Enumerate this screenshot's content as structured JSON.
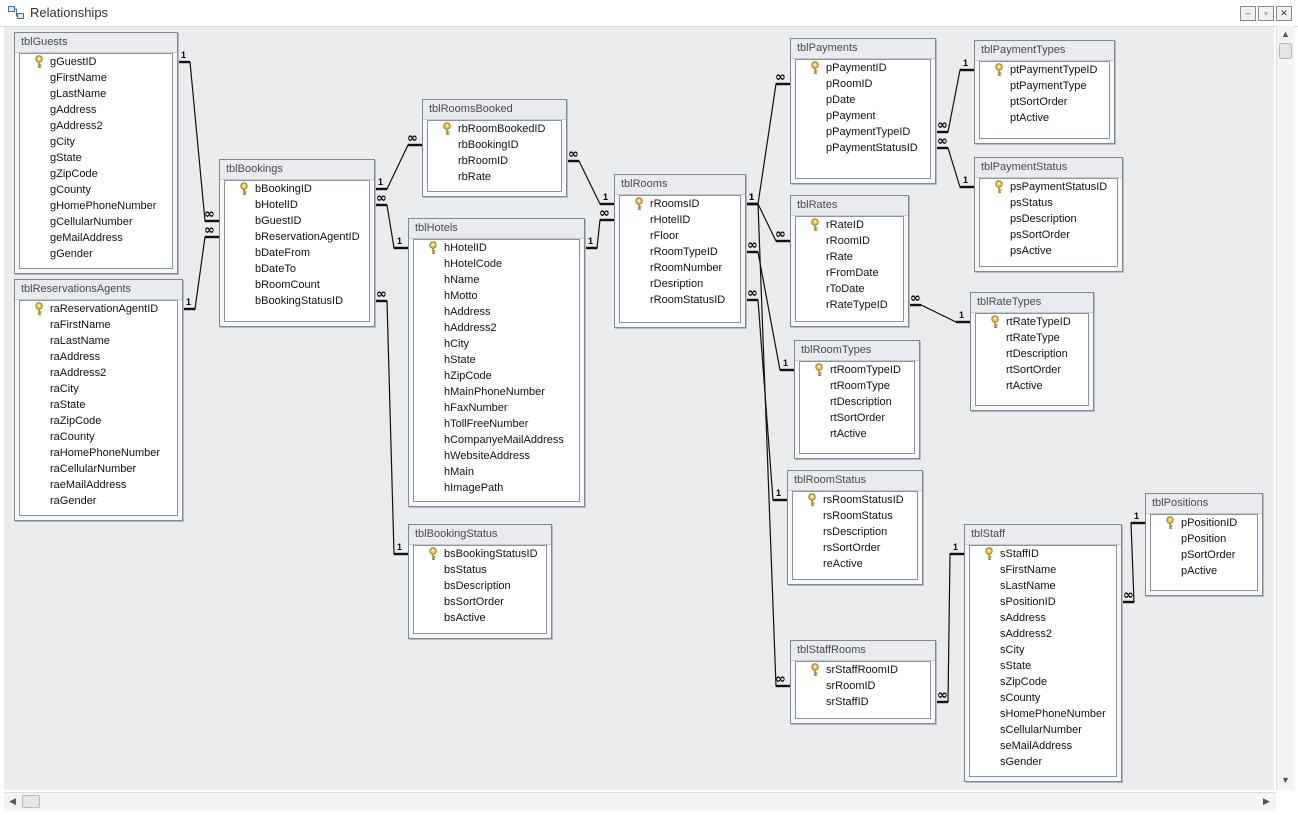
{
  "window": {
    "title": "Relationships",
    "minimize": "–",
    "restore": "▫",
    "close": "✕"
  },
  "tables": [
    {
      "id": "tblGuests",
      "name": "tblGuests",
      "fields": [
        {
          "name": "gGuestID",
          "pk": true
        },
        {
          "name": "gFirstName"
        },
        {
          "name": "gLastName"
        },
        {
          "name": "gAddress"
        },
        {
          "name": "gAddress2"
        },
        {
          "name": "gCity"
        },
        {
          "name": "gState"
        },
        {
          "name": "gZipCode"
        },
        {
          "name": "gCounty"
        },
        {
          "name": "gHomePhoneNumber"
        },
        {
          "name": "gCellularNumber"
        },
        {
          "name": "geMailAddress"
        },
        {
          "name": "gGender"
        }
      ]
    },
    {
      "id": "tblReservationsAgents",
      "name": "tblReservationsAgents",
      "fields": [
        {
          "name": "raReservationAgentID",
          "pk": true
        },
        {
          "name": "raFirstName"
        },
        {
          "name": "raLastName"
        },
        {
          "name": "raAddress"
        },
        {
          "name": "raAddress2"
        },
        {
          "name": "raCity"
        },
        {
          "name": "raState"
        },
        {
          "name": "raZipCode"
        },
        {
          "name": "raCounty"
        },
        {
          "name": "raHomePhoneNumber"
        },
        {
          "name": "raCellularNumber"
        },
        {
          "name": "raeMailAddress"
        },
        {
          "name": "raGender"
        }
      ]
    },
    {
      "id": "tblBookings",
      "name": "tblBookings",
      "fields": [
        {
          "name": "bBookingID",
          "pk": true
        },
        {
          "name": "bHotelID"
        },
        {
          "name": "bGuestID"
        },
        {
          "name": "bReservationAgentID"
        },
        {
          "name": "bDateFrom"
        },
        {
          "name": "bDateTo"
        },
        {
          "name": "bRoomCount"
        },
        {
          "name": "bBookingStatusID"
        }
      ]
    },
    {
      "id": "tblRoomsBooked",
      "name": "tblRoomsBooked",
      "fields": [
        {
          "name": "rbRoomBookedID",
          "pk": true
        },
        {
          "name": "rbBookingID"
        },
        {
          "name": "rbRoomID"
        },
        {
          "name": "rbRate"
        }
      ]
    },
    {
      "id": "tblHotels",
      "name": "tblHotels",
      "fields": [
        {
          "name": "hHotelID",
          "pk": true
        },
        {
          "name": "hHotelCode"
        },
        {
          "name": "hName"
        },
        {
          "name": "hMotto"
        },
        {
          "name": "hAddress"
        },
        {
          "name": "hAddress2"
        },
        {
          "name": "hCity"
        },
        {
          "name": "hState"
        },
        {
          "name": "hZipCode"
        },
        {
          "name": "hMainPhoneNumber"
        },
        {
          "name": "hFaxNumber"
        },
        {
          "name": "hTollFreeNumber"
        },
        {
          "name": "hCompanyeMailAddress"
        },
        {
          "name": "hWebsiteAddress"
        },
        {
          "name": "hMain"
        },
        {
          "name": "hImagePath"
        }
      ]
    },
    {
      "id": "tblBookingStatus",
      "name": "tblBookingStatus",
      "fields": [
        {
          "name": "bsBookingStatusID",
          "pk": true
        },
        {
          "name": "bsStatus"
        },
        {
          "name": "bsDescription"
        },
        {
          "name": "bsSortOrder"
        },
        {
          "name": "bsActive"
        }
      ]
    },
    {
      "id": "tblRooms",
      "name": "tblRooms",
      "fields": [
        {
          "name": "rRoomsID",
          "pk": true
        },
        {
          "name": "rHotelID"
        },
        {
          "name": "rFloor"
        },
        {
          "name": "rRoomTypeID"
        },
        {
          "name": "rRoomNumber"
        },
        {
          "name": "rDesription"
        },
        {
          "name": "rRoomStatusID"
        }
      ]
    },
    {
      "id": "tblPayments",
      "name": "tblPayments",
      "fields": [
        {
          "name": "pPaymentID",
          "pk": true
        },
        {
          "name": "pRoomID"
        },
        {
          "name": "pDate"
        },
        {
          "name": "pPayment"
        },
        {
          "name": "pPaymentTypeID"
        },
        {
          "name": "pPaymentStatusID"
        }
      ]
    },
    {
      "id": "tblPaymentTypes",
      "name": "tblPaymentTypes",
      "fields": [
        {
          "name": "ptPaymentTypeID",
          "pk": true
        },
        {
          "name": "ptPaymentType"
        },
        {
          "name": "ptSortOrder"
        },
        {
          "name": "ptActive"
        }
      ]
    },
    {
      "id": "tblPaymentStatus",
      "name": "tblPaymentStatus",
      "fields": [
        {
          "name": "psPaymentStatusID",
          "pk": true
        },
        {
          "name": "psStatus"
        },
        {
          "name": "psDescription"
        },
        {
          "name": "psSortOrder"
        },
        {
          "name": "psActive"
        }
      ]
    },
    {
      "id": "tblRates",
      "name": "tblRates",
      "fields": [
        {
          "name": "rRateID",
          "pk": true
        },
        {
          "name": "rRoomID"
        },
        {
          "name": "rRate"
        },
        {
          "name": "rFromDate"
        },
        {
          "name": "rToDate"
        },
        {
          "name": "rRateTypeID"
        }
      ]
    },
    {
      "id": "tblRateTypes",
      "name": "tblRateTypes",
      "fields": [
        {
          "name": "rtRateTypeID",
          "pk": true
        },
        {
          "name": "rtRateType"
        },
        {
          "name": "rtDescription"
        },
        {
          "name": "rtSortOrder"
        },
        {
          "name": "rtActive"
        }
      ]
    },
    {
      "id": "tblRoomTypes",
      "name": "tblRoomTypes",
      "fields": [
        {
          "name": "rtRoomTypeID",
          "pk": true
        },
        {
          "name": "rtRoomType"
        },
        {
          "name": "rtDescription"
        },
        {
          "name": "rtSortOrder"
        },
        {
          "name": "rtActive"
        }
      ]
    },
    {
      "id": "tblRoomStatus",
      "name": "tblRoomStatus",
      "fields": [
        {
          "name": "rsRoomStatusID",
          "pk": true
        },
        {
          "name": "rsRoomStatus"
        },
        {
          "name": "rsDescription"
        },
        {
          "name": "rsSortOrder"
        },
        {
          "name": "reActive"
        }
      ]
    },
    {
      "id": "tblStaffRooms",
      "name": "tblStaffRooms",
      "fields": [
        {
          "name": "srStaffRoomID",
          "pk": true
        },
        {
          "name": "srRoomID"
        },
        {
          "name": "srStaffID"
        }
      ]
    },
    {
      "id": "tblStaff",
      "name": "tblStaff",
      "fields": [
        {
          "name": "sStaffID",
          "pk": true
        },
        {
          "name": "sFirstName"
        },
        {
          "name": "sLastName"
        },
        {
          "name": "sPositionID"
        },
        {
          "name": "sAddress"
        },
        {
          "name": "sAddress2"
        },
        {
          "name": "sCity"
        },
        {
          "name": "sState"
        },
        {
          "name": "sZipCode"
        },
        {
          "name": "sCounty"
        },
        {
          "name": "sHomePhoneNumber"
        },
        {
          "name": "sCellularNumber"
        },
        {
          "name": "seMailAddress"
        },
        {
          "name": "sGender"
        }
      ]
    },
    {
      "id": "tblPositions",
      "name": "tblPositions",
      "fields": [
        {
          "name": "pPositionID",
          "pk": true
        },
        {
          "name": "pPosition"
        },
        {
          "name": "pSortOrder"
        },
        {
          "name": "pActive"
        }
      ]
    }
  ],
  "relationships": [
    {
      "one": "tblGuests.gGuestID",
      "many": "tblBookings.bGuestID",
      "one_label": "1",
      "many_label": "∞"
    },
    {
      "one": "tblReservationsAgents.raReservationAgentID",
      "many": "tblBookings.bReservationAgentID",
      "one_label": "1",
      "many_label": "∞"
    },
    {
      "one": "tblBookings.bBookingID",
      "many": "tblRoomsBooked.rbBookingID",
      "one_label": "1",
      "many_label": "∞"
    },
    {
      "one": "tblHotels.hHotelID",
      "many": "tblBookings.bHotelID",
      "one_label": "1",
      "many_label": "∞"
    },
    {
      "one": "tblBookingStatus.bsBookingStatusID",
      "many": "tblBookings.bBookingStatusID",
      "one_label": "1",
      "many_label": "∞"
    },
    {
      "one": "tblRooms.rRoomsID",
      "many": "tblRoomsBooked.rbRoomID",
      "one_label": "1",
      "many_label": "∞"
    },
    {
      "one": "tblHotels.hHotelID",
      "many": "tblRooms.rHotelID",
      "one_label": "1",
      "many_label": "∞"
    },
    {
      "one": "tblRooms.rRoomsID",
      "many": "tblPayments.pRoomID",
      "one_label": "1",
      "many_label": "∞"
    },
    {
      "one": "tblRooms.rRoomsID",
      "many": "tblRates.rRoomID",
      "one_label": "1",
      "many_label": "∞"
    },
    {
      "one": "tblRoomTypes.rtRoomTypeID",
      "many": "tblRooms.rRoomTypeID",
      "one_label": "1",
      "many_label": "∞"
    },
    {
      "one": "tblRoomStatus.rsRoomStatusID",
      "many": "tblRooms.rRoomStatusID",
      "one_label": "1",
      "many_label": "∞"
    },
    {
      "one": "tblRooms.rRoomsID",
      "many": "tblStaffRooms.srRoomID",
      "one_label": "1",
      "many_label": "∞"
    },
    {
      "one": "tblPaymentTypes.ptPaymentTypeID",
      "many": "tblPayments.pPaymentTypeID",
      "one_label": "1",
      "many_label": "∞"
    },
    {
      "one": "tblPaymentStatus.psPaymentStatusID",
      "many": "tblPayments.pPaymentStatusID",
      "one_label": "1",
      "many_label": "∞"
    },
    {
      "one": "tblRateTypes.rtRateTypeID",
      "many": "tblRates.rRateTypeID",
      "one_label": "1",
      "many_label": "∞"
    },
    {
      "one": "tblStaff.sStaffID",
      "many": "tblStaffRooms.srStaffID",
      "one_label": "1",
      "many_label": "∞"
    },
    {
      "one": "tblPositions.pPositionID",
      "many": "tblStaff.sPositionID",
      "one_label": "1",
      "many_label": "∞"
    }
  ],
  "scrollbars": {
    "vertical": "vertical-scrollbar",
    "horizontal": "horizontal-scrollbar"
  }
}
